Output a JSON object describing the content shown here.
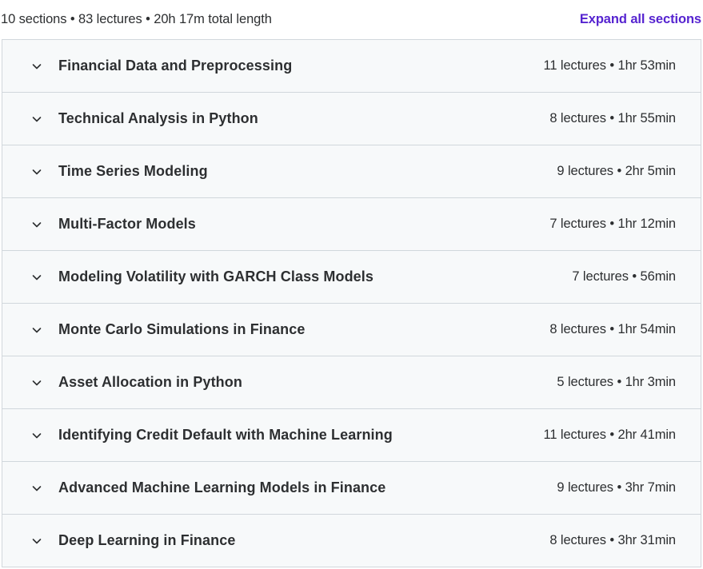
{
  "summary": {
    "text": "10 sections • 83 lectures • 20h 17m total length",
    "expand_label": "Expand all sections"
  },
  "colors": {
    "accent": "#5624d0",
    "section_bg": "#f7f9fa",
    "border": "#d1d7dc",
    "text": "#2d2f31"
  },
  "sections": [
    {
      "title": "Financial Data and Preprocessing",
      "meta": "11 lectures • 1hr 53min",
      "icon": "chevron-down-icon"
    },
    {
      "title": "Technical Analysis in Python",
      "meta": "8 lectures • 1hr 55min",
      "icon": "chevron-down-icon"
    },
    {
      "title": "Time Series Modeling",
      "meta": "9 lectures • 2hr 5min",
      "icon": "chevron-down-icon"
    },
    {
      "title": "Multi-Factor Models",
      "meta": "7 lectures • 1hr 12min",
      "icon": "chevron-down-icon"
    },
    {
      "title": "Modeling Volatility with GARCH Class Models",
      "meta": "7 lectures • 56min",
      "icon": "chevron-down-icon"
    },
    {
      "title": "Monte Carlo Simulations in Finance",
      "meta": "8 lectures • 1hr 54min",
      "icon": "chevron-down-icon"
    },
    {
      "title": "Asset Allocation in Python",
      "meta": "5 lectures • 1hr 3min",
      "icon": "chevron-down-icon"
    },
    {
      "title": "Identifying Credit Default with Machine Learning",
      "meta": "11 lectures • 2hr 41min",
      "icon": "chevron-down-icon"
    },
    {
      "title": "Advanced Machine Learning Models in Finance",
      "meta": "9 lectures • 3hr 7min",
      "icon": "chevron-down-icon"
    },
    {
      "title": "Deep Learning in Finance",
      "meta": "8 lectures • 3hr 31min",
      "icon": "chevron-down-icon"
    }
  ]
}
